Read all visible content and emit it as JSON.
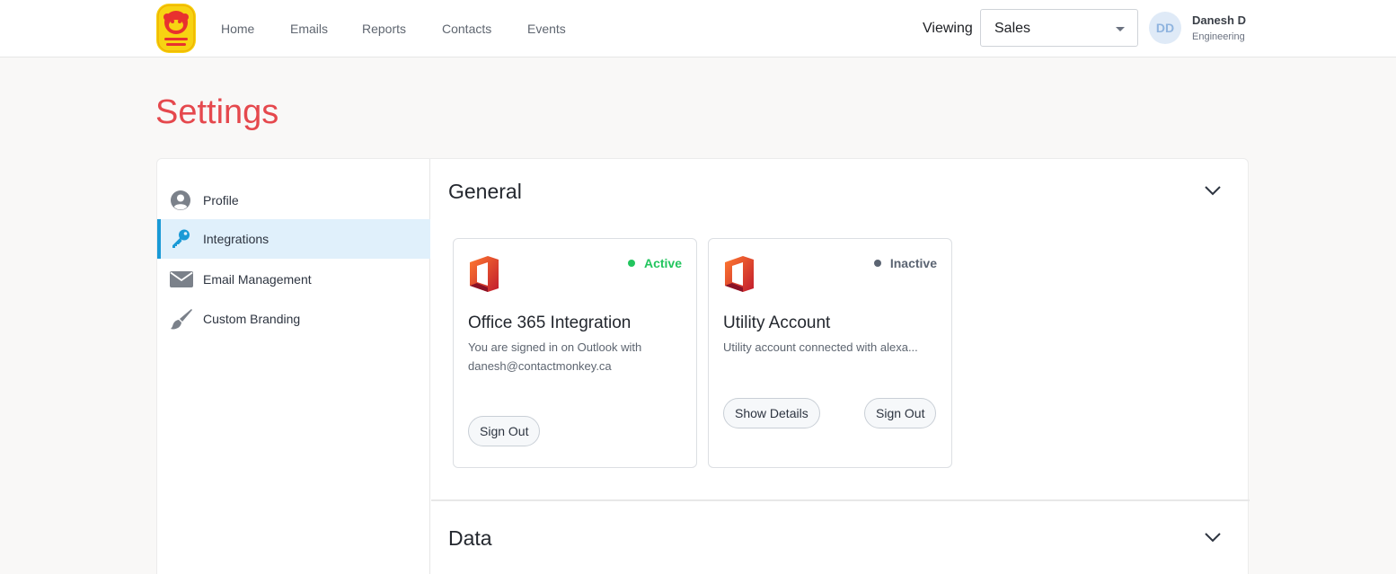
{
  "nav": {
    "links": [
      "Home",
      "Emails",
      "Reports",
      "Contacts",
      "Events"
    ],
    "viewing_label": "Viewing",
    "viewing_value": "Sales"
  },
  "user": {
    "initials": "DD",
    "name": "Danesh D",
    "department": "Engineering"
  },
  "page": {
    "title": "Settings"
  },
  "sidebar": {
    "items": [
      {
        "label": "Profile",
        "icon": "user-circle-icon"
      },
      {
        "label": "Integrations",
        "icon": "key-icon",
        "active": true
      },
      {
        "label": "Email Management",
        "icon": "envelope-icon"
      },
      {
        "label": "Custom Branding",
        "icon": "paintbrush-icon"
      }
    ]
  },
  "sections": {
    "general": "General",
    "data": "Data"
  },
  "cards": [
    {
      "title": "Office 365 Integration",
      "description": "You are signed in on Outlook with danesh@contactmonkey.ca",
      "status": "Active",
      "status_color": "#22c55e",
      "buttons": [
        "Sign Out"
      ]
    },
    {
      "title": "Utility Account",
      "description": "Utility account connected with alexa...",
      "status": "Inactive",
      "status_color": "#5b6472",
      "buttons": [
        "Show Details",
        "Sign Out"
      ]
    }
  ],
  "colors": {
    "accent": "#e5484d",
    "active_nav": "#1a9ad6",
    "active_bg": "#e0f0fb"
  }
}
